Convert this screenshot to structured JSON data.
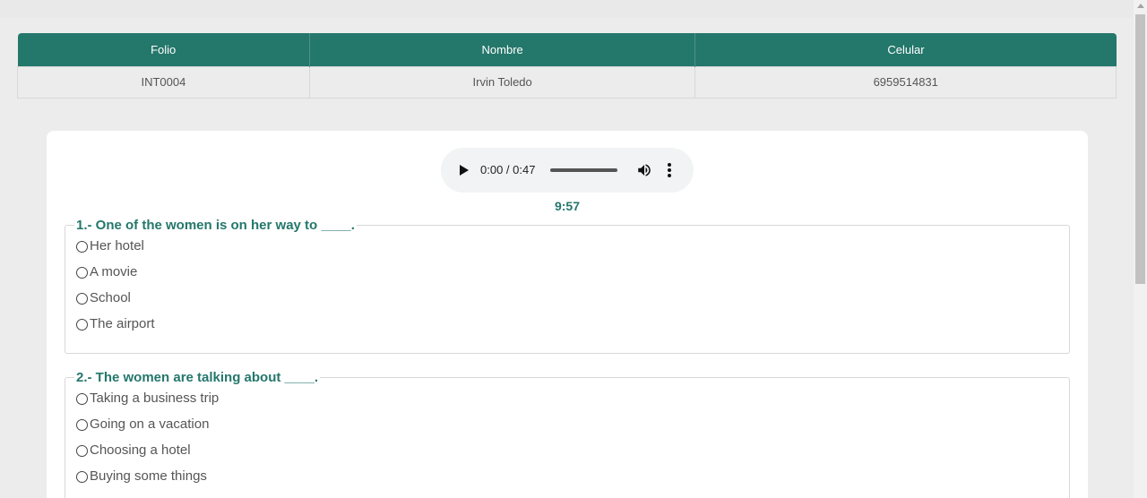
{
  "table": {
    "headers": [
      "Folio",
      "Nombre",
      "Celular"
    ],
    "row": [
      "INT0004",
      "Irvin Toledo",
      "6959514831"
    ]
  },
  "audio": {
    "time": "0:00 / 0:47",
    "icons": [
      "play-icon",
      "volume-icon",
      "more-options-icon"
    ]
  },
  "timer": "9:57",
  "questions": [
    {
      "title": "1.- One of the women is on her way to ____.",
      "options": [
        "Her hotel",
        "A movie",
        "School",
        "The airport"
      ]
    },
    {
      "title": "2.- The women are talking about ____.",
      "options": [
        "Taking a business trip",
        "Going on a vacation",
        "Choosing a hotel",
        "Buying some things"
      ]
    }
  ]
}
